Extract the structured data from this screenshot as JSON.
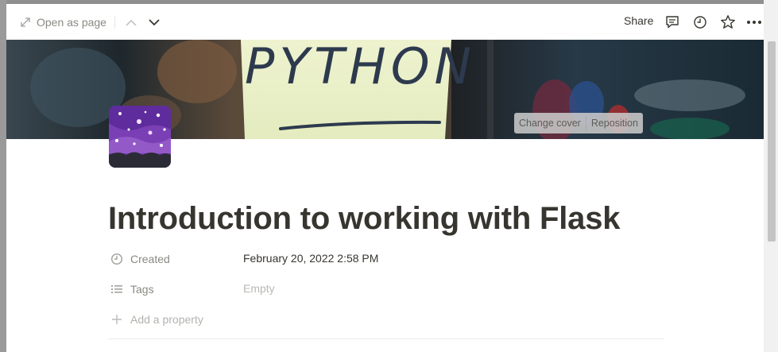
{
  "topbar": {
    "open_as_page_label": "Open as page",
    "share_label": "Share",
    "icons": [
      "expand-arrow-icon",
      "chevron-up-icon",
      "chevron-down-icon",
      "comment-icon",
      "clock-icon",
      "star-icon",
      "more-icon"
    ]
  },
  "cover": {
    "image_text": "PYTHON",
    "change_cover_label": "Change cover",
    "reposition_label": "Reposition"
  },
  "page": {
    "title": "Introduction to working with Flask",
    "properties": [
      {
        "name": "Created",
        "value": "February 20, 2022 2:58 PM",
        "icon": "clock-icon"
      },
      {
        "name": "Tags",
        "value": "Empty",
        "icon": "list-icon"
      }
    ],
    "add_property_label": "Add a property"
  }
}
